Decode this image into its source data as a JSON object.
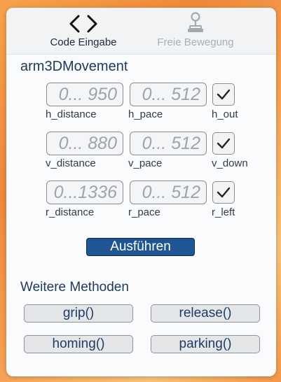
{
  "tabs": {
    "code": {
      "label": "Code Eingabe",
      "icon": "code-brackets-icon"
    },
    "free": {
      "label": "Freie Bewegung",
      "icon": "joystick-icon"
    }
  },
  "movement": {
    "title": "arm3DMovement",
    "rows": [
      {
        "distance": {
          "placeholder": "0... 950",
          "label": "h_distance"
        },
        "pace": {
          "placeholder": "0... 512",
          "label": "h_pace"
        },
        "toggle": {
          "label": "h_out",
          "checked": true
        }
      },
      {
        "distance": {
          "placeholder": "0... 880",
          "label": "v_distance"
        },
        "pace": {
          "placeholder": "0... 512",
          "label": "v_pace"
        },
        "toggle": {
          "label": "v_down",
          "checked": true
        }
      },
      {
        "distance": {
          "placeholder": "0...1336",
          "label": "r_distance"
        },
        "pace": {
          "placeholder": "0... 512",
          "label": "r_pace"
        },
        "toggle": {
          "label": "r_left",
          "checked": true
        }
      }
    ],
    "run_label": "Ausführen"
  },
  "methods": {
    "title": "Weitere Methoden",
    "buttons": [
      "grip()",
      "release()",
      "homing()",
      "parking()"
    ]
  },
  "colors": {
    "accent": "#1f5592",
    "title_text": "#203a5a",
    "background_orange": "#f0883a",
    "panel": "#fafbfc"
  }
}
